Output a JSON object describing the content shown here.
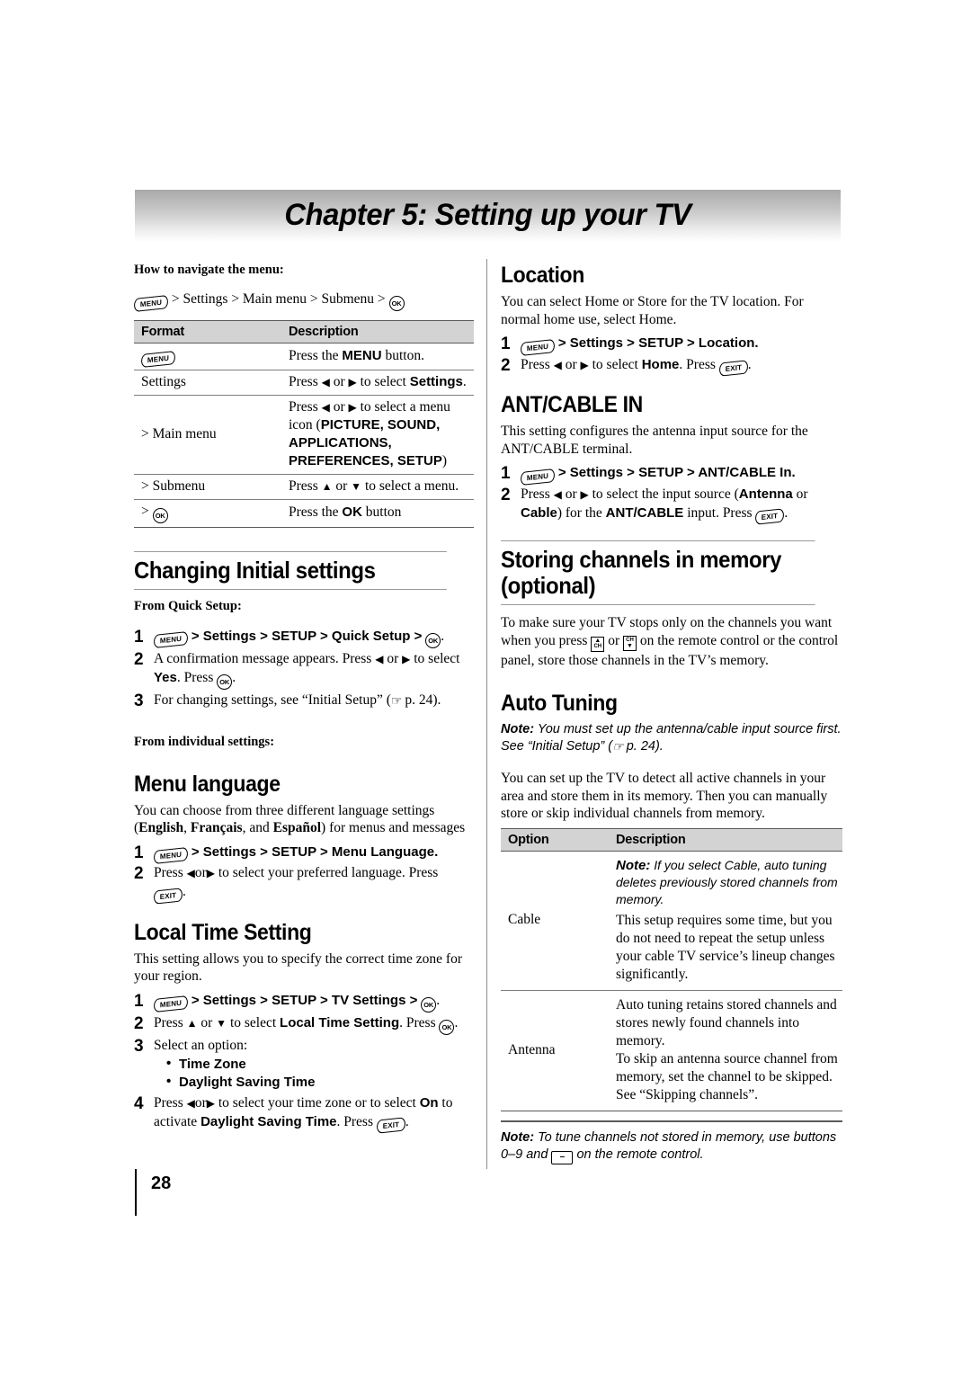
{
  "chapter": {
    "title": "Chapter 5: Setting up your TV"
  },
  "page": {
    "number": "28"
  },
  "icons": {
    "menu": "MENU",
    "exit": "EXIT",
    "ok": "OK",
    "ch": "CH",
    "dash": "–",
    "hand": "☞"
  },
  "left": {
    "navigate": {
      "lead": "How to navigate the menu:",
      "path_tail": "> Settings > Main menu > Submenu >",
      "table": {
        "headers": [
          "Format",
          "Description"
        ],
        "rows": [
          {
            "format_icon": "menu",
            "format": "",
            "desc_pre": "Press the ",
            "desc_bold": "MENU",
            "desc_post": " button."
          },
          {
            "format": "Settings",
            "desc_pre": "Press ",
            "desc_post": " to select ",
            "desc_bold2": "Settings",
            "desc_end": "."
          },
          {
            "format": "> Main menu",
            "desc_pre": "Press ",
            "desc_post": " to select a menu icon (",
            "menu_icons": "PICTURE, SOUND, APPLICATIONS, PREFERENCES, SETUP",
            "desc_end": ")"
          },
          {
            "format": "> Submenu",
            "desc_pre": "Press ",
            "desc_post": " to select a menu."
          },
          {
            "format_icon": "ok",
            "format": "> ",
            "desc_pre": "Press the ",
            "desc_bold": "OK",
            "desc_post": " button"
          }
        ]
      }
    },
    "changing": {
      "heading": "Changing Initial settings",
      "from_quick": "From Quick Setup:",
      "steps": [
        {
          "num": "1",
          "tail": "> Settings > SETUP > Quick Setup >"
        },
        {
          "num": "2",
          "a": "A confirmation message appears. Press ",
          "b": " to select ",
          "c": "Yes",
          "d": ". Press "
        },
        {
          "num": "3",
          "a": "For changing settings, see “Initial Setup” (",
          "b": " p. 24)."
        }
      ],
      "from_individual": "From individual settings:"
    },
    "menu_language": {
      "heading": "Menu language",
      "body_a": "You can choose from three different language settings (",
      "lang1": "English",
      "lang2": "Français",
      "lang3": "Español",
      "body_b": ") for menus and messages",
      "steps": [
        {
          "num": "1",
          "tail": "> Settings > SETUP > Menu Language."
        },
        {
          "num": "2",
          "a": "Press ",
          "b": " to select your preferred language. Press "
        }
      ]
    },
    "local_time": {
      "heading": "Local Time Setting",
      "body": "This setting allows you to specify the correct time zone for your region.",
      "steps": [
        {
          "num": "1",
          "tail": "> Settings > SETUP > TV Settings >"
        },
        {
          "num": "2",
          "a": "Press ",
          "b": " to select ",
          "c": "Local Time Setting",
          "d": ". Press "
        },
        {
          "num": "3",
          "a": "Select an option:"
        },
        {
          "num": "4",
          "a": "Press ",
          "b": " to select your time zone or to select ",
          "c": "On",
          "d": " to activate ",
          "e": "Daylight Saving Time",
          "f": ". Press "
        }
      ],
      "options": [
        "Time Zone",
        "Daylight Saving Time"
      ]
    }
  },
  "right": {
    "location": {
      "heading": "Location",
      "body": "You can select Home or Store for the TV location. For normal home use, select Home.",
      "steps": [
        {
          "num": "1",
          "tail": "> Settings > SETUP > Location."
        },
        {
          "num": "2",
          "a": "Press ",
          "b": " to select ",
          "c": "Home",
          "d": ". Press "
        }
      ]
    },
    "ant_cable": {
      "heading": "ANT/CABLE IN",
      "body": "This setting configures the antenna input source for the ANT/CABLE terminal.",
      "steps": [
        {
          "num": "1",
          "tail": "> Settings > SETUP > ANT/CABLE In."
        },
        {
          "num": "2",
          "a": "Press ",
          "b": " to select the input source (",
          "c": "Antenna",
          "d": " or ",
          "e": "Cable",
          "f": ") for the ",
          "g": "ANT/CABLE",
          "h": " input. Press "
        }
      ]
    },
    "storing": {
      "heading_l1": "Storing channels in memory",
      "heading_l2": "(optional)",
      "body_a": "To make sure your TV stops only on the channels you want when you press ",
      "body_b": " or ",
      "body_c": " on the remote control or the control panel, store those channels in the TV’s memory."
    },
    "auto_tuning": {
      "heading": "Auto Tuning",
      "note_label": "Note:",
      "note_a": " You must set up the antenna/cable input source first. See “Initial Setup” (",
      "note_b": " p. 24).",
      "body": "You can set up the TV to detect all active channels in your area and store them in its memory. Then you can manually store or skip individual channels from memory.",
      "table": {
        "headers": [
          "Option",
          "Description"
        ],
        "rows": [
          {
            "option": "Cable",
            "note_label": "Note:",
            "note_text": " If you select Cable, auto tuning deletes previously stored channels from memory.",
            "desc": "This setup requires some time, but you do not need to repeat the setup unless your cable TV service’s lineup changes significantly."
          },
          {
            "option": "Antenna",
            "desc": "Auto tuning retains stored channels and stores newly found channels into memory.\nTo skip an antenna source channel from memory, set the channel to be skipped. See “Skipping channels”."
          }
        ]
      },
      "footer_note_label": "Note:",
      "footer_note_a": " To tune channels not stored in memory, use buttons 0–9 and ",
      "footer_note_b": " on the remote control."
    }
  }
}
